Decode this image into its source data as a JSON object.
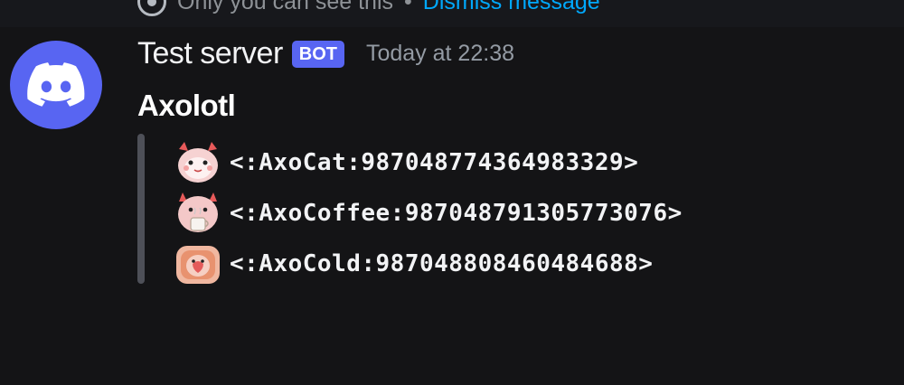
{
  "notice": {
    "text": "Only you can see this",
    "separator": "•",
    "dismiss_label": "Dismiss message"
  },
  "message": {
    "author": "Test server",
    "badge": "BOT",
    "timestamp": "Today at 22:38",
    "avatar_icon": "discord-logo-icon",
    "avatar_color": "#5865f2"
  },
  "embed": {
    "title": "Axolotl",
    "items": [
      {
        "icon": "axolotl-cat-emoji-icon",
        "code": "<:AxoCat:987048774364983329>"
      },
      {
        "icon": "axolotl-coffee-emoji-icon",
        "code": "<:AxoCoffee:987048791305773076>"
      },
      {
        "icon": "axolotl-cold-emoji-icon",
        "code": "<:AxoCold:987048808460484688>"
      }
    ]
  },
  "colors": {
    "background": "#141416",
    "blurple": "#5865f2",
    "link": "#00a8fc",
    "muted": "#949ba4"
  }
}
